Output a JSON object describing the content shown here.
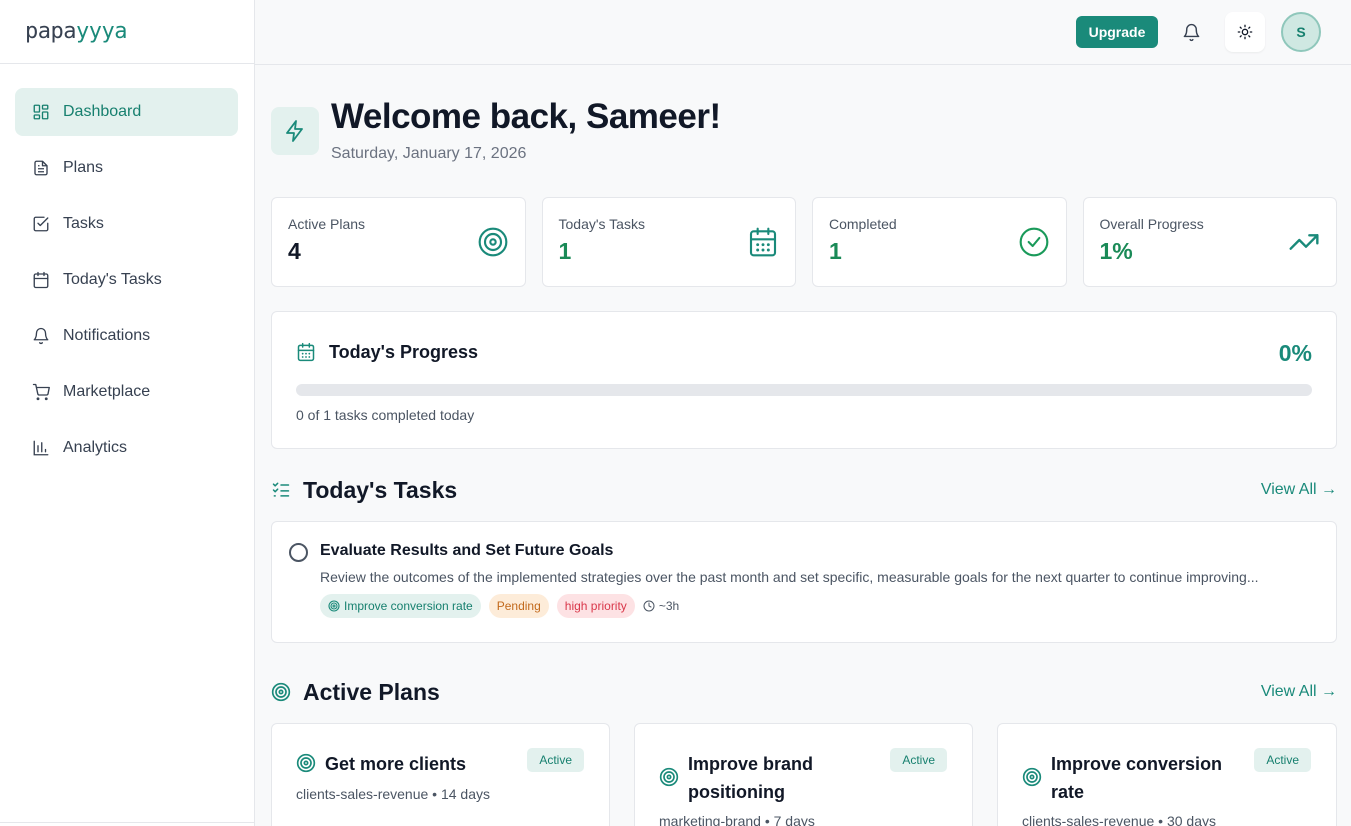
{
  "brand": {
    "logo_text": "papa",
    "logo_accent": "yyya"
  },
  "colors": {
    "accent": "#1a8a7a",
    "success": "#1a8a57",
    "accent_light": "#e3f1ee"
  },
  "sidebar": {
    "items": [
      {
        "label": "Dashboard",
        "icon": "dashboard-icon",
        "active": true
      },
      {
        "label": "Plans",
        "icon": "document-icon"
      },
      {
        "label": "Tasks",
        "icon": "checkbox-icon"
      },
      {
        "label": "Today's Tasks",
        "icon": "calendar-icon"
      },
      {
        "label": "Notifications",
        "icon": "bell-icon"
      },
      {
        "label": "Marketplace",
        "icon": "cart-icon"
      },
      {
        "label": "Analytics",
        "icon": "bar-chart-icon"
      }
    ]
  },
  "topbar": {
    "upgrade_label": "Upgrade",
    "avatar_initial": "S"
  },
  "welcome": {
    "title": "Welcome back, Sameer!",
    "date": "Saturday, January 17, 2026"
  },
  "stats": [
    {
      "label": "Active Plans",
      "value": "4",
      "icon": "target-icon"
    },
    {
      "label": "Today's Tasks",
      "value": "1",
      "icon": "calendar-icon"
    },
    {
      "label": "Completed",
      "value": "1",
      "icon": "check-circle-icon"
    },
    {
      "label": "Overall Progress",
      "value": "1%",
      "icon": "trending-up-icon"
    }
  ],
  "progress": {
    "title": "Today's Progress",
    "percent_label": "0%",
    "fraction": 0,
    "note": "0 of 1 tasks completed today"
  },
  "todays_tasks": {
    "title": "Today's Tasks",
    "view_all": "View All →",
    "items": [
      {
        "title": "Evaluate Results and Set Future Goals",
        "description": "Review the outcomes of the implemented strategies over the past month and set specific, measurable goals for the next quarter to continue improving...",
        "plan": "Improve conversion rate",
        "status": "Pending",
        "priority": "high priority",
        "estimate": "~3h"
      }
    ]
  },
  "active_plans": {
    "title": "Active Plans",
    "view_all": "View All →",
    "items": [
      {
        "title": "Get more clients",
        "meta": "clients-sales-revenue • 14 days",
        "badge": "Active"
      },
      {
        "title": "Improve brand positioning",
        "meta": "marketing-brand • 7 days",
        "badge": "Active"
      },
      {
        "title": "Improve conversion rate",
        "meta": "clients-sales-revenue • 30 days",
        "badge": "Active"
      }
    ]
  }
}
